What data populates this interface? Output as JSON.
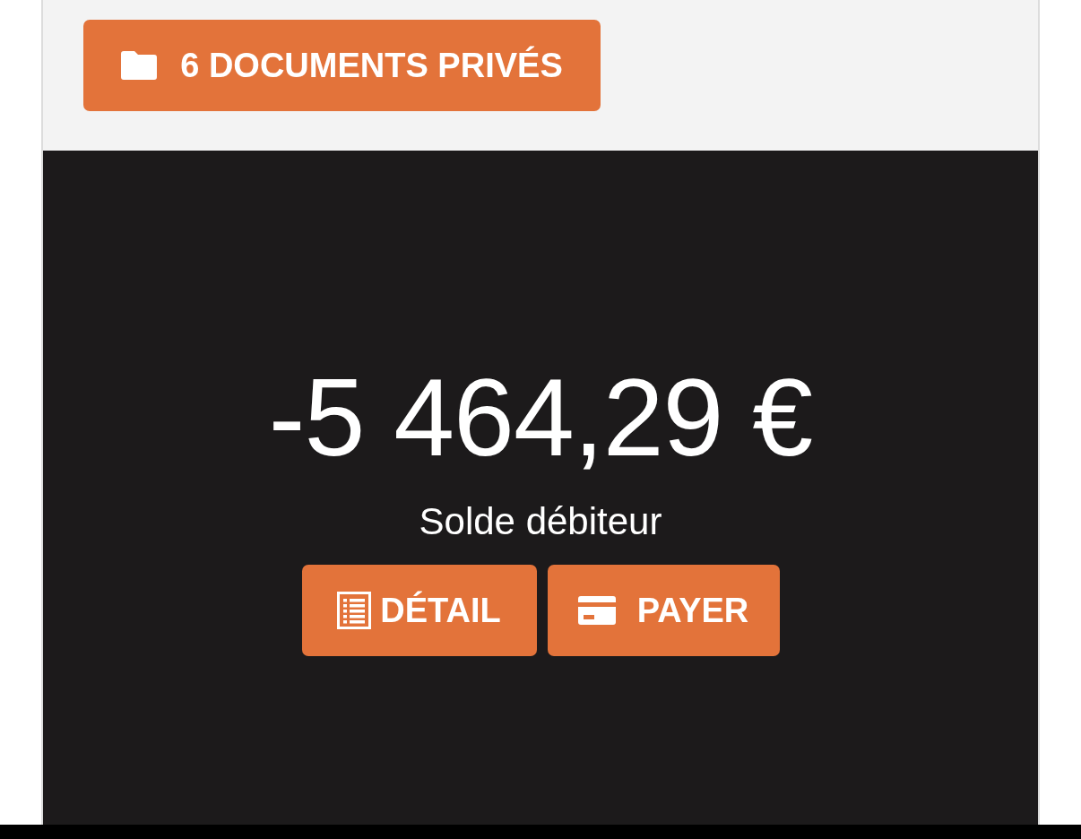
{
  "documents_button": {
    "label": "6 DOCUMENTS PRIVÉS"
  },
  "balance": {
    "amount": "-5 464,29 €",
    "caption": "Solde débiteur"
  },
  "actions": [
    {
      "kind": "list",
      "label": "DÉTAIL"
    },
    {
      "kind": "card",
      "label": "PAYER"
    }
  ]
}
